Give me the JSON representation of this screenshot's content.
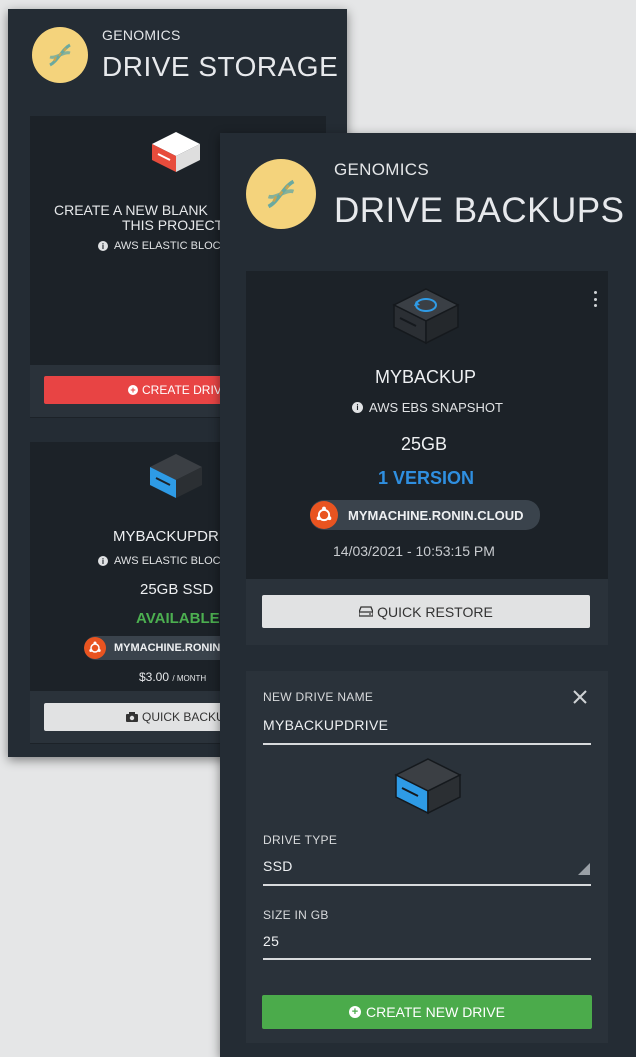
{
  "storage": {
    "project": "GENOMICS",
    "title": "DRIVE STORAGE",
    "new_drive_card": {
      "line1": "CREATE A NEW BLANK",
      "line2": "THIS PROJECT",
      "info": "AWS ELASTIC BLOCK",
      "button": "CREATE DRIVE"
    },
    "drive_card": {
      "name": "MYBACKUPDRI",
      "info": "AWS ELASTIC BLOCK",
      "size": "25GB SSD",
      "status": "AVAILABLE",
      "machine": "MYMACHINE.RONIN.",
      "price": "$3.00",
      "price_unit": "/ MONTH",
      "button": "QUICK BACKU"
    }
  },
  "backups": {
    "project": "GENOMICS",
    "title": "DRIVE BACKUPS",
    "backup_card": {
      "name": "MYBACKUP",
      "info": "AWS EBS SNAPSHOT",
      "size": "25GB",
      "versions": "1 VERSION",
      "machine": "MYMACHINE.RONIN.CLOUD",
      "timestamp": "14/03/2021 - 10:53:15 PM",
      "button": "QUICK RESTORE"
    },
    "form": {
      "name_label": "NEW DRIVE NAME",
      "name_value": "MYBACKUPDRIVE",
      "type_label": "DRIVE TYPE",
      "type_value": "SSD",
      "size_label": "SIZE IN GB",
      "size_value": "25",
      "submit": "CREATE NEW DRIVE"
    }
  },
  "colors": {
    "panel": "#242c34",
    "card": "#1c2228",
    "accent_blue": "#2f8fe0",
    "status_green": "#4caf50",
    "danger_red": "#e84444",
    "logo_yellow": "#f4d37c",
    "ubuntu_orange": "#e95420"
  },
  "icons": [
    "dna-icon",
    "drive-icon",
    "backup-drive-icon",
    "info-icon",
    "ubuntu-icon",
    "plus-circle-icon",
    "camera-icon",
    "hdd-icon",
    "close-icon",
    "more-vert-icon",
    "dropdown-triangle-icon"
  ]
}
